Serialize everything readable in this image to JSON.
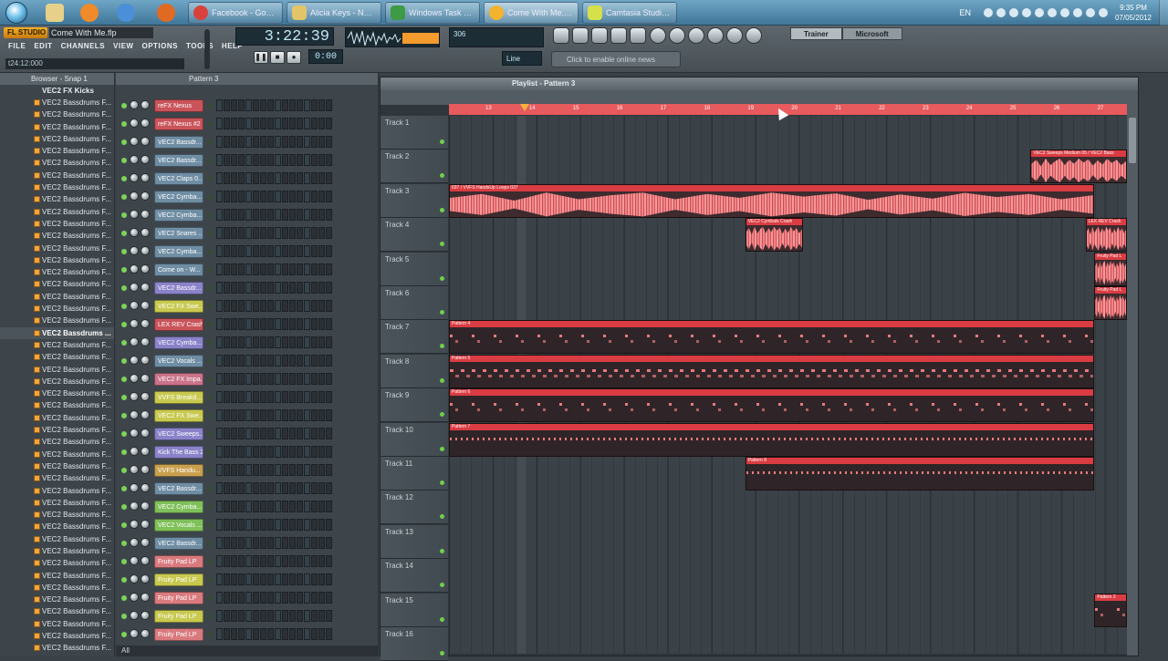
{
  "taskbar": {
    "buttons": [
      {
        "label": "Facebook - Googl..."
      },
      {
        "label": "Alicia Keys - No O..."
      },
      {
        "label": "Windows Task M..."
      },
      {
        "label": "Come With Me.fl..."
      },
      {
        "label": "Camtasia Studio -..."
      }
    ],
    "lang": "EN",
    "time": "9:35 PM",
    "date": "07/05/2012"
  },
  "fl": {
    "logo": "FL STUDIO",
    "song": "Come With Me.flp",
    "menu": [
      "FILE",
      "EDIT",
      "CHANNELS",
      "VIEW",
      "OPTIONS",
      "TOOLS",
      "HELP"
    ],
    "hint": "t24:12:000",
    "time": "3:22:39",
    "tempo": "0:00",
    "cpu": "306",
    "news": "Click to enable online news",
    "tabs": [
      "Trainer",
      "Microsoft"
    ],
    "line": "Line"
  },
  "browser": {
    "title": "Browser - Snap 1",
    "folder": "VEC2 FX Kicks",
    "items": [
      "VEC2 Bassdrums F...",
      "VEC2 Bassdrums F...",
      "VEC2 Bassdrums F...",
      "VEC2 Bassdrums F...",
      "VEC2 Bassdrums F...",
      "VEC2 Bassdrums F...",
      "VEC2 Bassdrums F...",
      "VEC2 Bassdrums F...",
      "VEC2 Bassdrums F...",
      "VEC2 Bassdrums F...",
      "VEC2 Bassdrums F...",
      "VEC2 Bassdrums F...",
      "VEC2 Bassdrums F...",
      "VEC2 Bassdrums F...",
      "VEC2 Bassdrums F...",
      "VEC2 Bassdrums F...",
      "VEC2 Bassdrums F...",
      "VEC2 Bassdrums F...",
      "VEC2 Bassdrums F...",
      "VEC2 Bassdrums ...",
      "VEC2 Bassdrums F...",
      "VEC2 Bassdrums F...",
      "VEC2 Bassdrums F...",
      "VEC2 Bassdrums F...",
      "VEC2 Bassdrums F...",
      "VEC2 Bassdrums F...",
      "VEC2 Bassdrums F...",
      "VEC2 Bassdrums F...",
      "VEC2 Bassdrums F...",
      "VEC2 Bassdrums F...",
      "VEC2 Bassdrums F...",
      "VEC2 Bassdrums F...",
      "VEC2 Bassdrums F...",
      "VEC2 Bassdrums F...",
      "VEC2 Bassdrums F...",
      "VEC2 Bassdrums F...",
      "VEC2 Bassdrums F...",
      "VEC2 Bassdrums F...",
      "VEC2 Bassdrums F...",
      "VEC2 Bassdrums F...",
      "VEC2 Bassdrums F...",
      "VEC2 Bassdrums F...",
      "VEC2 Bassdrums F...",
      "VEC2 Bassdrums F...",
      "VEC2 Bassdrums F...",
      "VEC2 Bassdrums F..."
    ],
    "active_index": 19
  },
  "rack": {
    "title": "Pattern 3",
    "footer": "All",
    "channels": [
      {
        "name": "reFX Nexus",
        "color": "#c9545a"
      },
      {
        "name": "reFX Nexus #2",
        "color": "#c9545a"
      },
      {
        "name": "VEC2 Bassdr...",
        "color": "#6f8da3"
      },
      {
        "name": "VEC2 Bassdr...",
        "color": "#6f8da3"
      },
      {
        "name": "VEC2 Claps 0...",
        "color": "#6f8da3"
      },
      {
        "name": "VEC2 Cymba...",
        "color": "#6f8da3"
      },
      {
        "name": "VEC2 Cymba...",
        "color": "#6f8da3"
      },
      {
        "name": "VEC2 Snares ...",
        "color": "#6f8da3"
      },
      {
        "name": "VEC2 Cymba...",
        "color": "#6f8da3"
      },
      {
        "name": "Come on - W...",
        "color": "#6f8da3"
      },
      {
        "name": "VEC2 Bassdr...",
        "color": "#8a83c9"
      },
      {
        "name": "VEC2 FX Swe...",
        "color": "#c8c94f"
      },
      {
        "name": "LEX REV Crash",
        "color": "#c9545a"
      },
      {
        "name": "VEC2 Cymba...",
        "color": "#8a83c9"
      },
      {
        "name": "VEC2 Vocals ...",
        "color": "#6f8da3"
      },
      {
        "name": "VEC2 FX Impa...",
        "color": "#c9738a"
      },
      {
        "name": "VVFS Breakd...",
        "color": "#c8c94f"
      },
      {
        "name": "VEC2 FX Swe...",
        "color": "#c8c94f"
      },
      {
        "name": "VEC2 Sweeps...",
        "color": "#8a83c9"
      },
      {
        "name": "Kick The Bass 2",
        "color": "#8a83c9"
      },
      {
        "name": "VVFS Handu...",
        "color": "#c9a04f"
      },
      {
        "name": "VEC2 Bassdr...",
        "color": "#6f8da3"
      },
      {
        "name": "VEC2 Cymba...",
        "color": "#7fc05a"
      },
      {
        "name": "VEC2 Vocals ...",
        "color": "#7fc05a"
      },
      {
        "name": "VEC2 Bassdr...",
        "color": "#6f8da3"
      },
      {
        "name": "Fruity Pad LP",
        "color": "#d97a7e"
      },
      {
        "name": "Fruity Pad LP",
        "color": "#c8c94f"
      },
      {
        "name": "Fruity Pad LP",
        "color": "#d97a7e"
      },
      {
        "name": "Fruity Pad LP",
        "color": "#c8c94f"
      },
      {
        "name": "Fruity Pad LP",
        "color": "#d97a7e"
      }
    ]
  },
  "playlist": {
    "title": "Playlist - Pattern 3",
    "ruler": [
      "13",
      "14",
      "15",
      "16",
      "17",
      "18",
      "19",
      "20",
      "21",
      "22",
      "23",
      "24",
      "25",
      "26",
      "27"
    ],
    "tracks": [
      "Track 1",
      "Track 2",
      "Track 3",
      "Track 4",
      "Track 5",
      "Track 6",
      "Track 7",
      "Track 8",
      "Track 9",
      "Track 10",
      "Track 11",
      "Track 12",
      "Track 13",
      "Track 14",
      "Track 15",
      "Track 16"
    ],
    "clips": [
      {
        "track": 1,
        "start": 0.858,
        "end": 1.0,
        "label": "VEC2 Sweeps Medium 05 / VEC2 Bass",
        "kind": "audio"
      },
      {
        "track": 2,
        "start": 0.0,
        "end": 0.952,
        "label": "037 / VVFS HandsUp Loops 037",
        "kind": "audio"
      },
      {
        "track": 3,
        "start": 0.437,
        "end": 0.522,
        "label": "VEC2 Cymbals Crash",
        "kind": "audio"
      },
      {
        "track": 3,
        "start": 0.939,
        "end": 1.0,
        "label": "LEX REV Crash",
        "kind": "audio"
      },
      {
        "track": 4,
        "start": 0.952,
        "end": 1.0,
        "label": "Fruity Pad L",
        "kind": "audio"
      },
      {
        "track": 5,
        "start": 0.952,
        "end": 1.0,
        "label": "Fruity Pad L",
        "kind": "audio"
      },
      {
        "track": 6,
        "start": 0.0,
        "end": 0.952,
        "label": "Pattern 4",
        "kind": "pattern",
        "notes": "sparse"
      },
      {
        "track": 7,
        "start": 0.0,
        "end": 0.952,
        "label": "Pattern 5",
        "kind": "pattern",
        "notes": "normal"
      },
      {
        "track": 8,
        "start": 0.0,
        "end": 0.952,
        "label": "Pattern 6",
        "kind": "pattern",
        "notes": "sparse"
      },
      {
        "track": 9,
        "start": 0.0,
        "end": 0.952,
        "label": "Pattern 7",
        "kind": "pattern",
        "notes": "dense"
      },
      {
        "track": 10,
        "start": 0.437,
        "end": 0.952,
        "label": "Pattern 8",
        "kind": "pattern",
        "notes": "dense"
      },
      {
        "track": 14,
        "start": 0.952,
        "end": 1.0,
        "label": "Pattern 2",
        "kind": "pattern",
        "notes": "sparse"
      }
    ]
  }
}
